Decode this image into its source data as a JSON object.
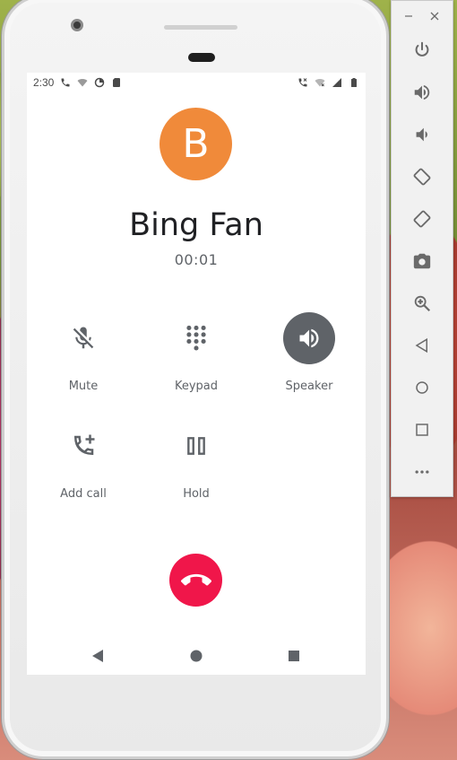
{
  "status_bar": {
    "time": "2:30",
    "icons_left": [
      "phone-call-icon",
      "wifi-calling-icon",
      "data-saver-icon",
      "sd-card-icon"
    ],
    "icons_right": [
      "call-status-icon",
      "wifi-off-icon",
      "signal-icon",
      "battery-icon"
    ]
  },
  "caller": {
    "initial": "B",
    "name": "Bing Fan",
    "timer": "00:01",
    "avatar_color": "#f08a3a"
  },
  "controls": [
    {
      "id": "mute",
      "label": "Mute",
      "icon": "mic-off-icon",
      "active": false
    },
    {
      "id": "keypad",
      "label": "Keypad",
      "icon": "dialpad-icon",
      "active": false
    },
    {
      "id": "speaker",
      "label": "Speaker",
      "icon": "speaker-icon",
      "active": true
    },
    {
      "id": "add_call",
      "label": "Add call",
      "icon": "add-call-icon",
      "active": false
    },
    {
      "id": "hold",
      "label": "Hold",
      "icon": "pause-icon",
      "active": false
    }
  ],
  "end_call": {
    "icon": "call-end-icon",
    "color": "#f0164a"
  },
  "nav_bar": {
    "back": "back-icon",
    "home": "home-icon",
    "recents": "recents-icon"
  },
  "emulator_toolbar": {
    "window_controls": [
      "minimize-icon",
      "close-icon"
    ],
    "buttons": [
      "power-icon",
      "volume-up-icon",
      "volume-down-icon",
      "rotate-left-icon",
      "rotate-right-icon",
      "camera-icon",
      "zoom-icon",
      "back-icon",
      "home-icon",
      "overview-icon",
      "more-icon"
    ]
  },
  "colors": {
    "accent_active": "#5f6368",
    "text_primary": "#202124",
    "text_secondary": "#5f6368"
  }
}
